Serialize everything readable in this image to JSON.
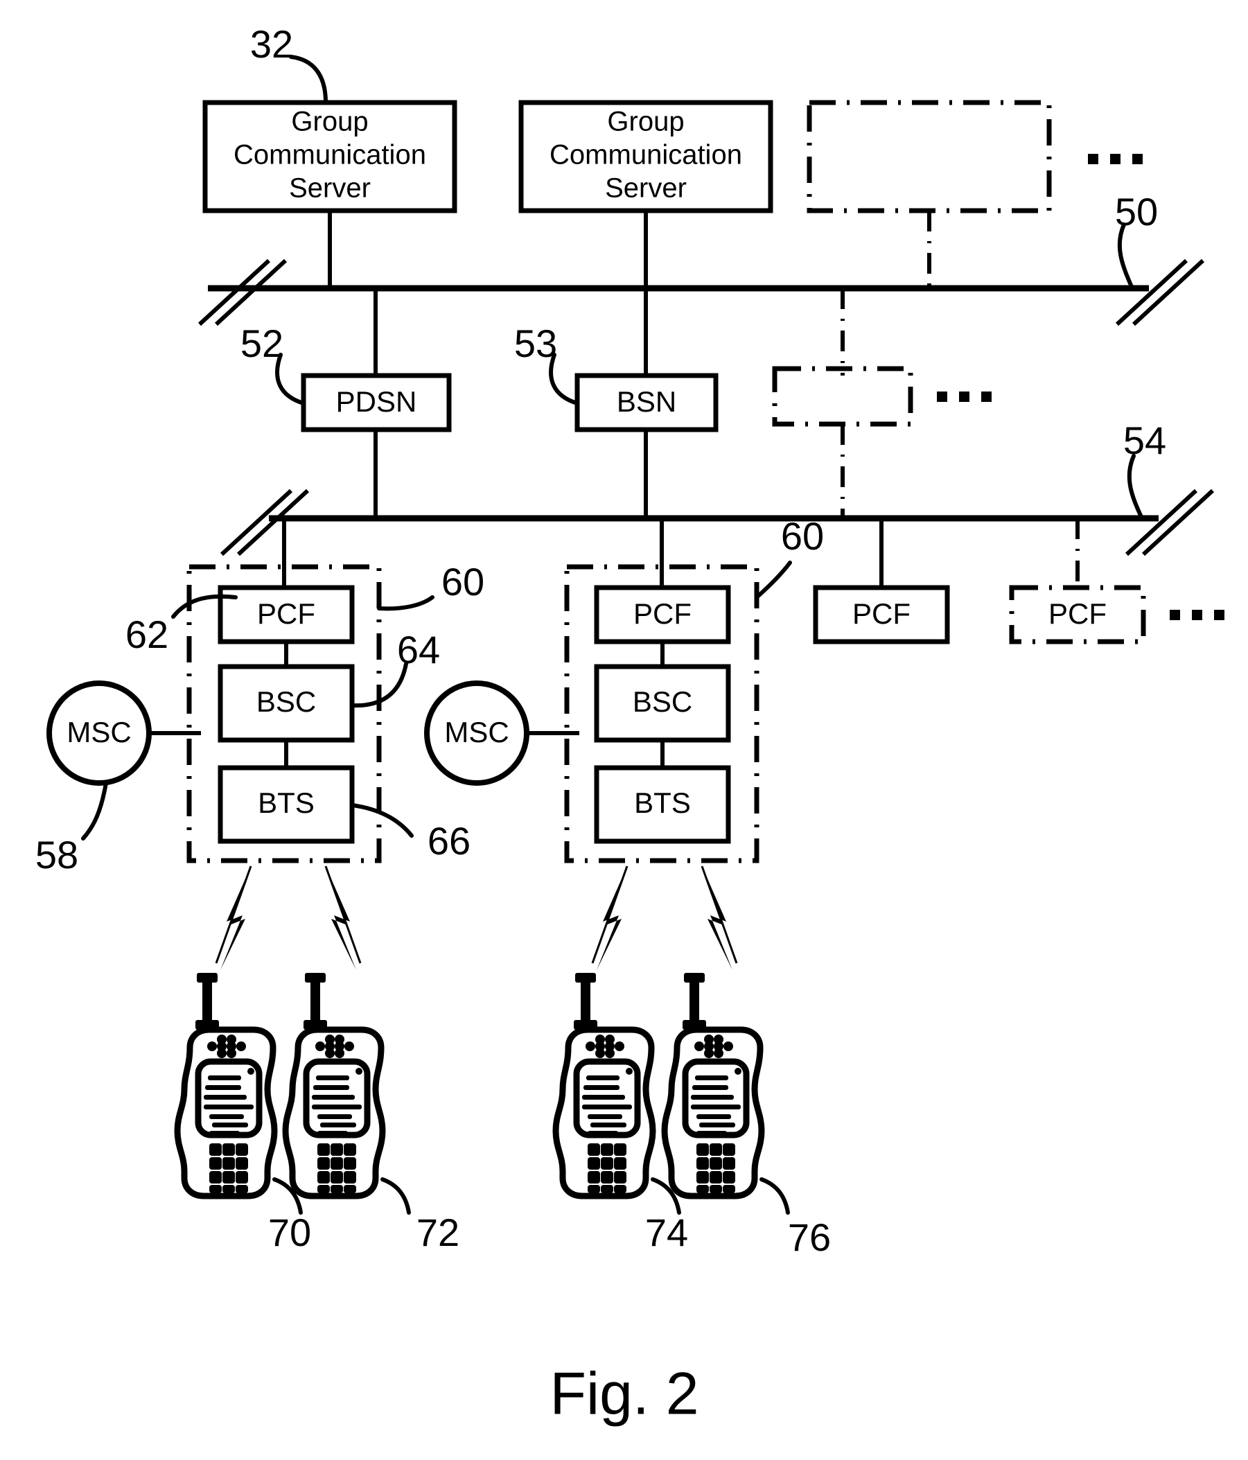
{
  "figure": {
    "caption": "Fig. 2",
    "ellipsis": "..."
  },
  "servers": [
    {
      "id": "gcs-1",
      "line1": "Group",
      "line2": "Communication",
      "line3": "Server",
      "style": "solid",
      "ref": "32"
    },
    {
      "id": "gcs-2",
      "line1": "Group",
      "line2": "Communication",
      "line3": "Server",
      "style": "solid",
      "ref": ""
    },
    {
      "id": "gcs-3",
      "line1": "",
      "line2": "",
      "line3": "",
      "style": "dashdot",
      "ref": ""
    }
  ],
  "buses": [
    {
      "id": "bus-upper",
      "ref": "50"
    },
    {
      "id": "bus-lower",
      "ref": "54"
    }
  ],
  "nodes": [
    {
      "id": "pdsn",
      "label": "PDSN",
      "ref": "52",
      "style": "solid"
    },
    {
      "id": "bsn",
      "label": "BSN",
      "ref": "53",
      "style": "solid"
    },
    {
      "id": "node-placeholder",
      "label": "",
      "ref": "",
      "style": "dashdot"
    }
  ],
  "access_groups": [
    {
      "id": "group-1",
      "ref": "60",
      "style": "dashdot",
      "elements": [
        {
          "id": "pcf-1",
          "label": "PCF",
          "ref": "62"
        },
        {
          "id": "bsc-1",
          "label": "BSC",
          "ref": "64"
        },
        {
          "id": "bts-1",
          "label": "BTS",
          "ref": "66"
        }
      ],
      "msc": {
        "id": "msc-1",
        "label": "MSC",
        "ref": "58"
      }
    },
    {
      "id": "group-2",
      "ref": "60",
      "style": "dashdot",
      "elements": [
        {
          "id": "pcf-2",
          "label": "PCF",
          "ref": ""
        },
        {
          "id": "bsc-2",
          "label": "BSC",
          "ref": ""
        },
        {
          "id": "bts-2",
          "label": "BTS",
          "ref": ""
        }
      ],
      "msc": {
        "id": "msc-2",
        "label": "MSC",
        "ref": ""
      }
    }
  ],
  "extra_pcfs": [
    {
      "id": "pcf-3",
      "label": "PCF",
      "style": "solid"
    },
    {
      "id": "pcf-4",
      "label": "PCF",
      "style": "dashdot"
    }
  ],
  "mobile_stations": [
    {
      "id": "ms-70",
      "ref": "70"
    },
    {
      "id": "ms-72",
      "ref": "72"
    },
    {
      "id": "ms-74",
      "ref": "74"
    },
    {
      "id": "ms-76",
      "ref": "76"
    }
  ]
}
